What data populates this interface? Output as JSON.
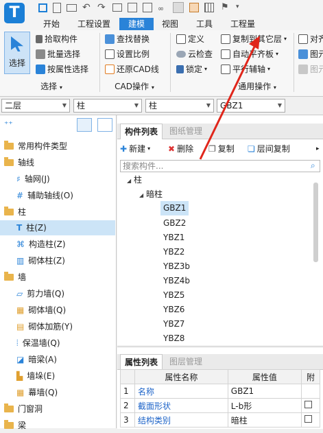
{
  "ribbon_tabs": [
    "开始",
    "工程设置",
    "建模",
    "视图",
    "工具",
    "工程量"
  ],
  "ribbon": {
    "select_label": "选择",
    "pick_label": "拾取构件",
    "batch_label": "批量选择",
    "attr_select_label": "按属性选择",
    "group_select": "选择",
    "find_replace": "查找替换",
    "set_scale": "设置比例",
    "restore_cad": "还原CAD线",
    "group_cad": "CAD操作",
    "define": "定义",
    "cloud_check": "云检查",
    "lock": "锁定",
    "copy_to_other": "复制到其它层",
    "auto_align": "自动平齐板",
    "parallel_axis": "平行辅轴",
    "group_common": "通用操作",
    "align_cut": "对齐",
    "layer_cut": "图元",
    "layer_cut2": "图元"
  },
  "combos": [
    "二层",
    "柱",
    "柱",
    "GBZ1"
  ],
  "nav_tree": [
    {
      "label": "常用构件类型",
      "type": "folder"
    },
    {
      "label": "轴线",
      "type": "folder"
    },
    {
      "label": "轴网(J)",
      "type": "leaf"
    },
    {
      "label": "辅助轴线(O)",
      "type": "leaf"
    },
    {
      "label": "柱",
      "type": "folder"
    },
    {
      "label": "柱(Z)",
      "type": "leaf",
      "selected": true
    },
    {
      "label": "构造柱(Z)",
      "type": "leaf"
    },
    {
      "label": "砌体柱(Z)",
      "type": "leaf"
    },
    {
      "label": "墙",
      "type": "folder"
    },
    {
      "label": "剪力墙(Q)",
      "type": "leaf"
    },
    {
      "label": "砌体墙(Q)",
      "type": "leaf"
    },
    {
      "label": "砌体加筋(Y)",
      "type": "leaf"
    },
    {
      "label": "保温墙(Q)",
      "type": "leaf"
    },
    {
      "label": "暗梁(A)",
      "type": "leaf"
    },
    {
      "label": "墙垛(E)",
      "type": "leaf"
    },
    {
      "label": "幕墙(Q)",
      "type": "leaf"
    },
    {
      "label": "门窗洞",
      "type": "folder"
    },
    {
      "label": "梁",
      "type": "folder"
    }
  ],
  "component_panel": {
    "tabs": [
      "构件列表",
      "图纸管理"
    ],
    "toolbar": {
      "new": "新建",
      "delete": "删除",
      "copy": "复制",
      "layer_copy": "层间复制"
    },
    "search_placeholder": "搜索构件...",
    "root": "柱",
    "group": "暗柱",
    "items": [
      "GBZ1",
      "GBZ2",
      "YBZ1",
      "YBZ2",
      "YBZ3b",
      "YBZ4b",
      "YBZ5",
      "YBZ6",
      "YBZ7",
      "YBZ8"
    ],
    "selected": "GBZ1"
  },
  "properties_panel": {
    "tabs": [
      "属性列表",
      "图层管理"
    ],
    "headers": [
      "属性名称",
      "属性值",
      "附"
    ],
    "rows": [
      {
        "no": "1",
        "name": "名称",
        "value": "GBZ1"
      },
      {
        "no": "2",
        "name": "截面形状",
        "value": "L-b形"
      },
      {
        "no": "3",
        "name": "结构类别",
        "value": "暗柱"
      }
    ]
  },
  "colors": {
    "accent": "#2a83d8",
    "arrow": "#e0261b",
    "selected": "#cce4f7"
  }
}
